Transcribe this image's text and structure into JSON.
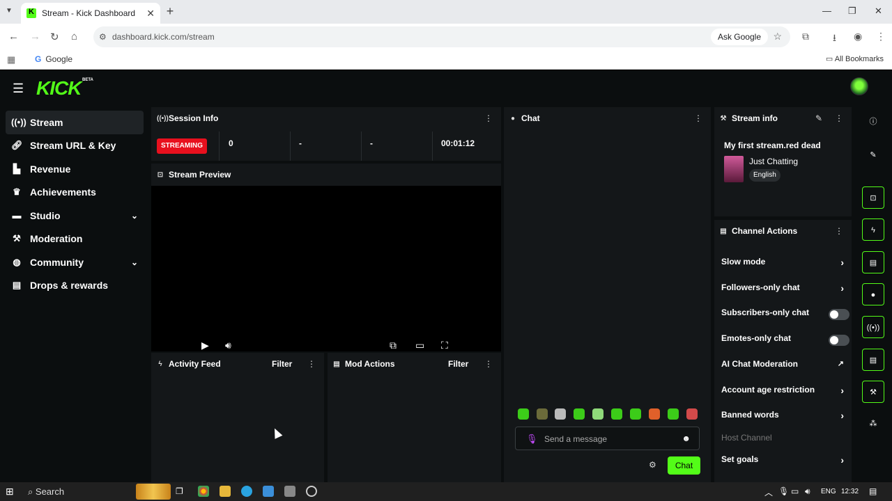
{
  "browser": {
    "tab_title": "Stream - Kick Dashboard",
    "url": "dashboard.kick.com/stream",
    "ask_google": "Ask Google",
    "bookmark_google": "Google",
    "all_bookmarks": "All Bookmarks"
  },
  "app": {
    "logo": "KICK",
    "beta": "BETA",
    "accent_color": "#53fc18"
  },
  "sidebar": {
    "items": [
      {
        "label": "Stream",
        "icon": "broadcast-icon",
        "active": true
      },
      {
        "label": "Stream URL & Key",
        "icon": "link-icon"
      },
      {
        "label": "Revenue",
        "icon": "chart-icon"
      },
      {
        "label": "Achievements",
        "icon": "trophy-icon"
      },
      {
        "label": "Studio",
        "icon": "studio-icon",
        "expandable": true
      },
      {
        "label": "Moderation",
        "icon": "wrench-icon"
      },
      {
        "label": "Community",
        "icon": "globe-icon",
        "expandable": true
      },
      {
        "label": "Drops & rewards",
        "icon": "gift-icon"
      }
    ]
  },
  "session_info": {
    "title": "Session Info",
    "status": "STREAMING",
    "stats": [
      "0",
      "-",
      "-",
      "00:01:12"
    ]
  },
  "stream_preview": {
    "title": "Stream Preview"
  },
  "activity_feed": {
    "title": "Activity Feed",
    "filter": "Filter"
  },
  "mod_actions": {
    "title": "Mod Actions",
    "filter": "Filter"
  },
  "chat": {
    "title": "Chat",
    "placeholder": "Send a message",
    "send_label": "Chat"
  },
  "stream_info": {
    "title": "Stream info",
    "stream_title": "My first stream.red dead",
    "category": "Just Chatting",
    "language": "English"
  },
  "channel_actions": {
    "title": "Channel Actions",
    "items": [
      {
        "label": "Slow mode",
        "control": "arrow"
      },
      {
        "label": "Followers-only chat",
        "control": "arrow"
      },
      {
        "label": "Subscribers-only chat",
        "control": "toggle",
        "enabled": false
      },
      {
        "label": "Emotes-only chat",
        "control": "toggle",
        "enabled": false
      },
      {
        "label": "AI Chat Moderation",
        "control": "external"
      },
      {
        "label": "Account age restriction",
        "control": "arrow"
      },
      {
        "label": "Banned words",
        "control": "arrow"
      },
      {
        "label": "Host Channel",
        "control": "none",
        "disabled": true
      },
      {
        "label": "Set goals",
        "control": "arrow"
      }
    ]
  },
  "taskbar": {
    "search": "Search",
    "lang": "ENG",
    "time": "12:32"
  }
}
